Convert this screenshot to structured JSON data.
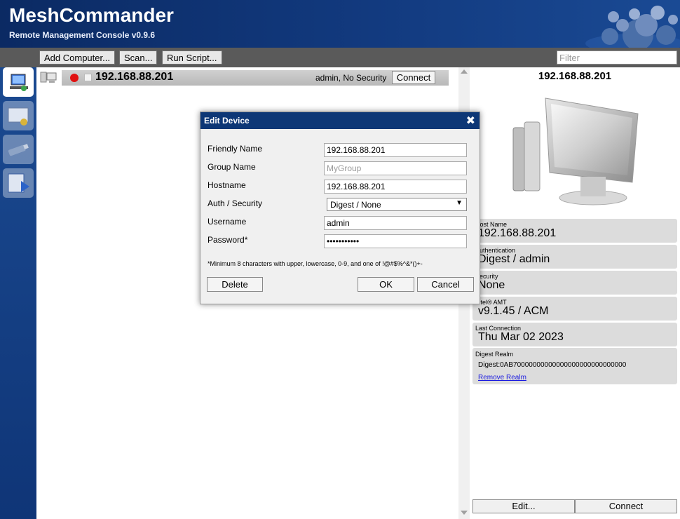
{
  "header": {
    "title": "MeshCommander",
    "subtitle": "Remote Management Console v0.9.6"
  },
  "toolbar": {
    "add_computer": "Add Computer...",
    "scan": "Scan...",
    "run_script": "Run Script...",
    "filter_placeholder": "Filter"
  },
  "device_list": {
    "devices": [
      {
        "ip": "192.168.88.201",
        "status": "admin, No Security",
        "connect_label": "Connect"
      }
    ]
  },
  "details": {
    "title": "192.168.88.201",
    "host_name_label": "Host Name",
    "host_name": "192.168.88.201",
    "auth_label": "Authentication",
    "auth": "Digest / admin",
    "security_label": "Security",
    "security": "None",
    "amt_label": "Intel® AMT",
    "amt": "v9.1.45 / ACM",
    "last_conn_label": "Last Connection",
    "last_conn": "Thu Mar 02 2023",
    "realm_label": "Digest Realm",
    "realm": "Digest:0AB70000000000000000000000000000",
    "remove_realm": "Remove Realm",
    "edit_button": "Edit...",
    "connect_button": "Connect"
  },
  "dialog": {
    "title": "Edit Device",
    "close_glyph": "✖",
    "friendly_name_label": "Friendly Name",
    "friendly_name": "192.168.88.201",
    "group_name_label": "Group Name",
    "group_name_placeholder": "MyGroup",
    "hostname_label": "Hostname",
    "hostname": "192.168.88.201",
    "auth_label": "Auth / Security",
    "auth_value": "Digest / None",
    "username_label": "Username",
    "username": "admin",
    "password_label": "Password*",
    "password": "•••••••••••",
    "note": "*Minimum 8 characters with upper, lowercase, 0-9, and one of !@#$%^&*()+-",
    "delete": "Delete",
    "ok": "OK",
    "cancel": "Cancel"
  },
  "colors": {
    "header_blue": "#0b2a63",
    "dialog_header": "#0d3776",
    "status_red": "#e01010",
    "panel_gray": "#dcdcdc"
  }
}
